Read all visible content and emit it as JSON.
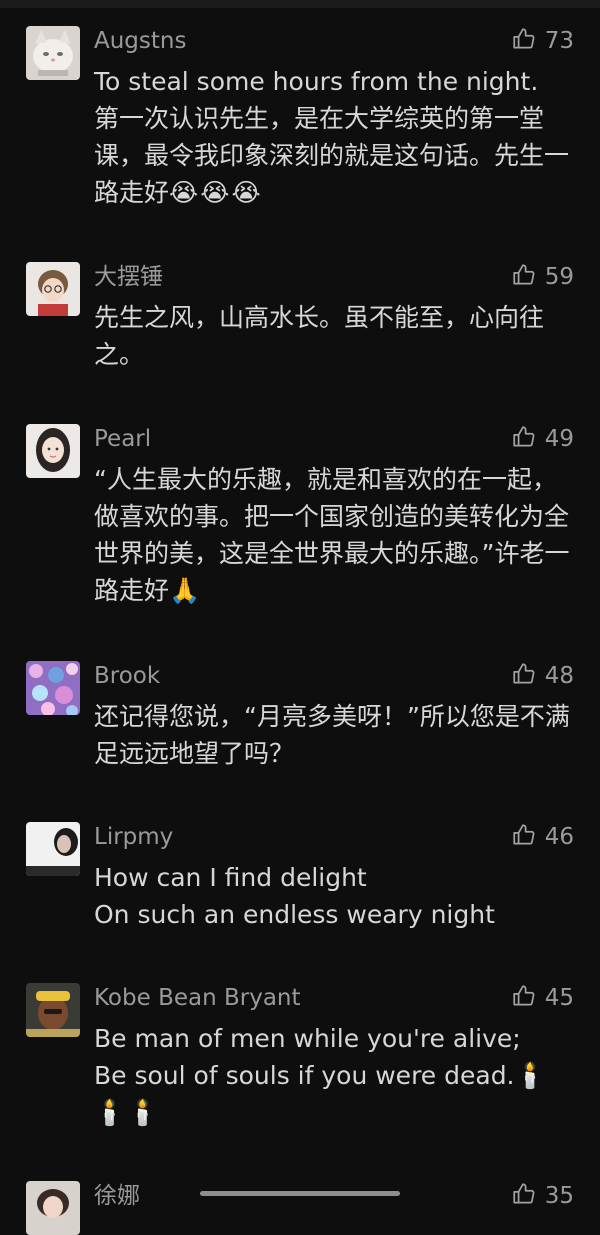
{
  "comments": [
    {
      "username": "Augstns",
      "likes": "73",
      "text": "To steal some hours from the night.\n第一次认识先生，是在大学综英的第一堂课，最令我印象深刻的就是这句话。先生一路走好",
      "emoji": "😭😭😭"
    },
    {
      "username": "大摆锤",
      "likes": "59",
      "text": "先生之风，山高水长。虽不能至，心向往之。",
      "emoji": ""
    },
    {
      "username": "Pearl",
      "likes": "49",
      "text": "“人生最大的乐趣，就是和喜欢的在一起，做喜欢的事。把一个国家创造的美转化为全世界的美，这是全世界最大的乐趣。”许老一路走好",
      "emoji": "🙏"
    },
    {
      "username": "Brook",
      "likes": "48",
      "text": "还记得您说，“月亮多美呀！”所以您是不满足远远地望了吗？",
      "emoji": ""
    },
    {
      "username": "Lirpmy",
      "likes": "46",
      "text": "How can I find delight\nOn such an endless weary night",
      "emoji": ""
    },
    {
      "username": "Kobe Bean Bryant",
      "likes": "45",
      "text": "Be man of men while you're alive;\nBe soul of souls if you were dead.",
      "emoji": "🕯️🕯️🕯️"
    },
    {
      "username": "徐娜",
      "likes": "35",
      "text": "",
      "emoji": ""
    }
  ],
  "icons": {
    "like": "thumbs-up-icon"
  },
  "colors": {
    "background": "#0e0e0f",
    "text": "#d7d7d7",
    "meta": "#9a9a9c"
  }
}
